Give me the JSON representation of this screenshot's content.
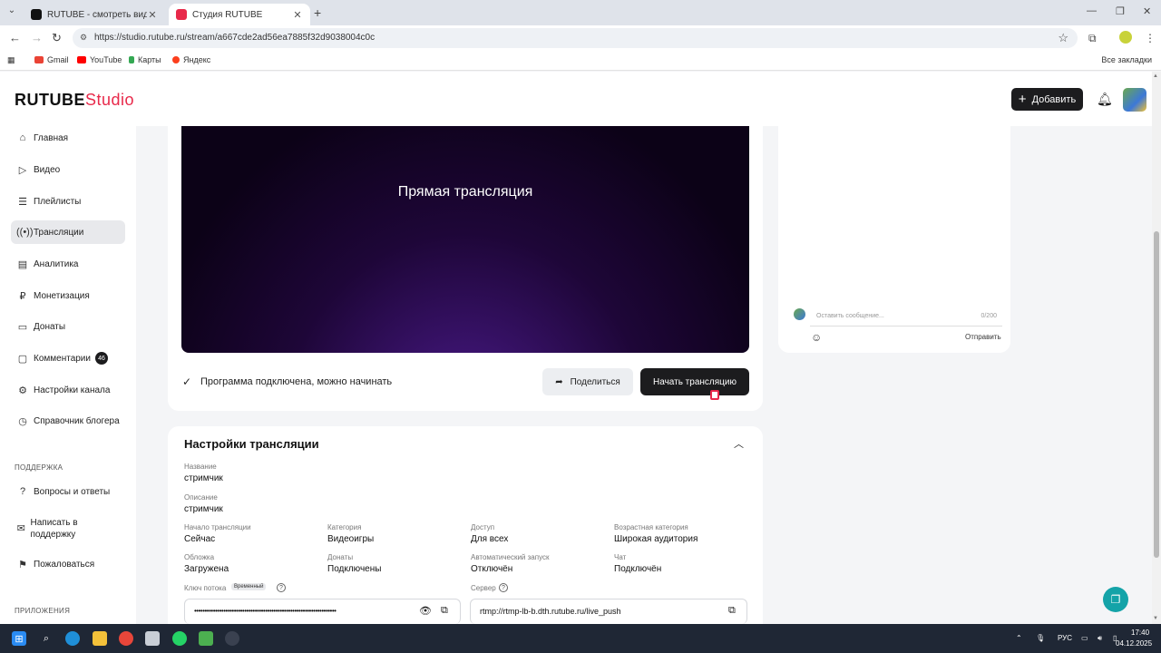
{
  "browser": {
    "tabs": [
      {
        "title": "RUTUBE - смотреть видео онлайн"
      },
      {
        "title": "Студия RUTUBE"
      }
    ],
    "url": "https://studio.rutube.ru/stream/a667cde2ad56ea7885f32d9038004c0c",
    "bookmarks": [
      "Gmail",
      "YouTube",
      "Карты",
      "Яндекс"
    ],
    "all_bookmarks": "Все закладки"
  },
  "header": {
    "logo_main": "RUTUBE",
    "logo_studio": "Studio",
    "add_button": "Добавить"
  },
  "sidebar": {
    "items": [
      {
        "label": "Главная",
        "icon": "home-icon"
      },
      {
        "label": "Видео",
        "icon": "video-icon"
      },
      {
        "label": "Плейлисты",
        "icon": "playlist-icon"
      },
      {
        "label": "Трансляции",
        "icon": "broadcast-icon"
      },
      {
        "label": "Аналитика",
        "icon": "analytics-icon"
      },
      {
        "label": "Монетизация",
        "icon": "monetization-icon"
      },
      {
        "label": "Донаты",
        "icon": "donations-icon"
      },
      {
        "label": "Комментарии",
        "icon": "comments-icon",
        "badge": "46"
      },
      {
        "label": "Настройки канала",
        "icon": "gear-icon"
      },
      {
        "label": "Справочник блогера",
        "icon": "book-icon"
      }
    ],
    "support_section": "ПОДДЕРЖКА",
    "support_items": [
      {
        "label": "Вопросы и ответы"
      },
      {
        "label": "Написать в поддержку"
      },
      {
        "label": "Пожаловаться"
      }
    ],
    "apps_section": "ПРИЛОЖЕНИЯ"
  },
  "preview": {
    "title": "Прямая трансляция"
  },
  "status": {
    "text": "Программа подключена, можно начинать",
    "share_button": "Поделиться",
    "start_button": "Начать трансляцию"
  },
  "settings": {
    "title": "Настройки трансляции",
    "name_label": "Название",
    "name_value": "стримчик",
    "description_label": "Описание",
    "description_value": "стримчик",
    "fields": [
      {
        "label": "Начало трансляции",
        "value": "Сейчас"
      },
      {
        "label": "Категория",
        "value": "Видеоигры"
      },
      {
        "label": "Доступ",
        "value": "Для всех"
      },
      {
        "label": "Возрастная категория",
        "value": "Широкая аудитория"
      },
      {
        "label": "Обложка",
        "value": "Загружена"
      },
      {
        "label": "Донаты",
        "value": "Подключены"
      },
      {
        "label": "Автоматический запуск",
        "value": "Отключён"
      },
      {
        "label": "Чат",
        "value": "Подключён"
      }
    ],
    "stream_key_label": "Ключ потока",
    "stream_key_tag": "Временный",
    "stream_key_value": "••••••••••••••••••••••••••••••••••••••••••••••••••••••••••••••••••••",
    "server_label": "Сервер",
    "server_value": "rtmp://rtmp-lb-b.dth.rutube.ru/live_push"
  },
  "chat": {
    "placeholder": "Оставить сообщение...",
    "counter": "0/200",
    "send": "Отправить"
  },
  "taskbar": {
    "lang": "РУС",
    "time": "17:40",
    "date": "04.12.2025"
  },
  "colors": {
    "accent": "#e8294a",
    "dark_button": "#1c1c1e",
    "support_fab": "#14a3a8"
  }
}
